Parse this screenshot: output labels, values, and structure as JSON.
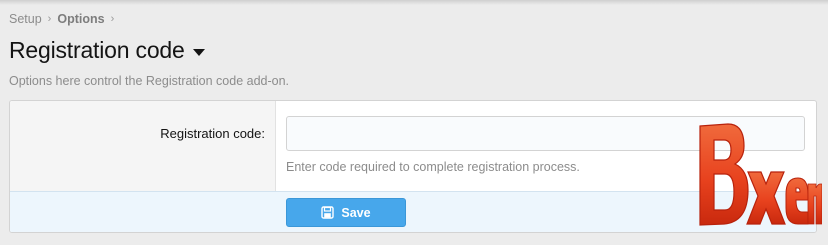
{
  "breadcrumb": {
    "items": [
      {
        "label": "Setup"
      },
      {
        "label": "Options"
      }
    ],
    "separator": "›"
  },
  "header": {
    "title": "Registration code",
    "description": "Options here control the Registration code add-on."
  },
  "form": {
    "field_label": "Registration code:",
    "input_value": "",
    "input_placeholder": "",
    "hint": "Enter code required to complete registration process.",
    "save_label": "Save",
    "save_icon": "floppy-disk-icon"
  },
  "watermark": {
    "text": "Bxen",
    "colors": {
      "fill": "#e8421e",
      "stroke": "#b8220c"
    }
  },
  "colors": {
    "accent": "#47a7eb",
    "muted_text": "#8c8c8c",
    "background": "#ececec"
  }
}
